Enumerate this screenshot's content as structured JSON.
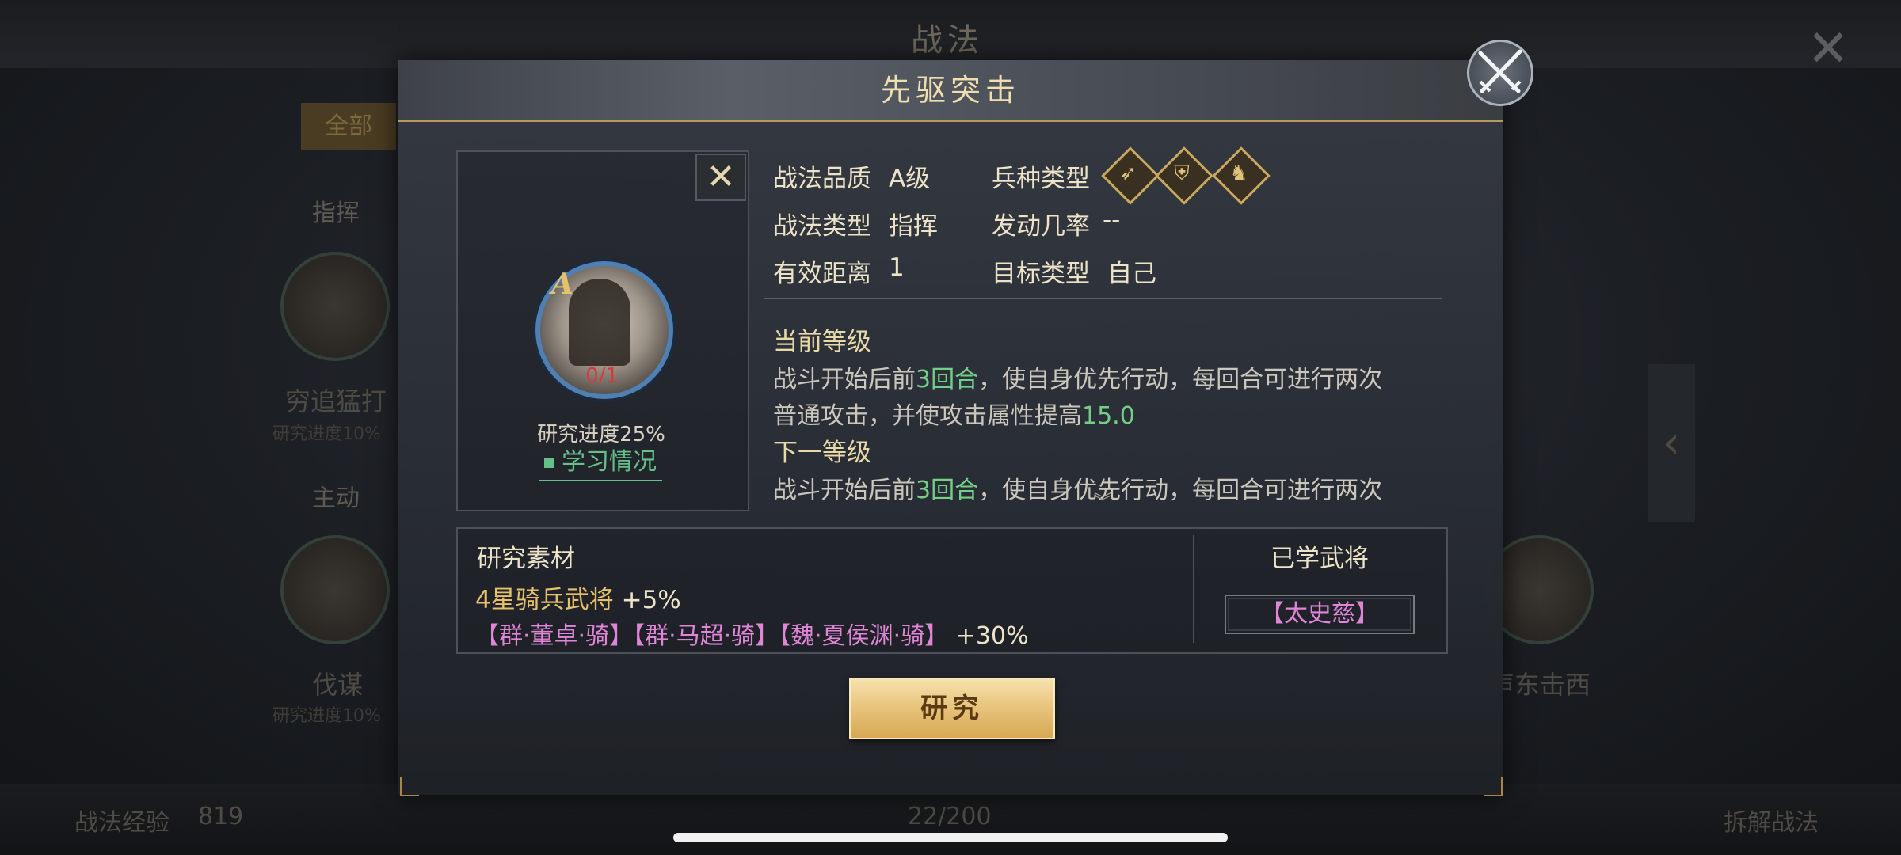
{
  "background": {
    "title": "战法",
    "tab_all": "全部",
    "section_command": "指挥",
    "section_active": "主动",
    "left_skill_1": "穷追猛打",
    "left_skill_1_sub": "研究进度10%",
    "left_skill_2": "伐谋",
    "left_skill_2_sub": "研究进度10%",
    "right_skill": "声东击西",
    "exp_label": "战法经验",
    "exp_value": "819",
    "page_count": "22/200",
    "disassemble_label": "拆解战法"
  },
  "dialog": {
    "title": "先驱突击",
    "portrait": {
      "grade": "A",
      "count": "0/1",
      "research_progress": "研究进度25%",
      "learn_status": "学习情况"
    },
    "info": {
      "quality_label": "战法品质",
      "quality_value": "A级",
      "troop_label": "兵种类型",
      "type_label": "战法类型",
      "type_value": "指挥",
      "trigger_label": "发动几率",
      "trigger_value": "--",
      "range_label": "有效距离",
      "range_value": "1",
      "target_label": "目标类型",
      "target_value": "自己",
      "troop_icons": [
        "archer-icon",
        "shield-icon",
        "cavalry-icon"
      ]
    },
    "current_level": {
      "heading": "当前等级",
      "line1_a": "战斗开始后前",
      "line1_hl": "3回合",
      "line1_b": "，使自身优先行动，每回合可进行两次",
      "line2_a": "普通攻击，并使攻击属性提高",
      "line2_hl": "15.0"
    },
    "next_level": {
      "heading": "下一等级",
      "line1_a": "战斗开始后前",
      "line1_hl": "3回合",
      "line1_b": "，使自身优先行动，每回合可进行两次"
    },
    "materials": {
      "title": "研究素材",
      "line1_text": "4星骑兵武将",
      "line1_pct": "+5%",
      "line2_generals": "【群·董卓·骑】【群·马超·骑】【魏·夏侯渊·骑】",
      "line2_pct": "+30%"
    },
    "learned": {
      "title": "已学武将",
      "general": "【太史慈】"
    },
    "research_button": "研究"
  },
  "colors": {
    "highlight_green": "#74cf86",
    "gold": "#e6c06a",
    "purple": "#e085d8"
  }
}
